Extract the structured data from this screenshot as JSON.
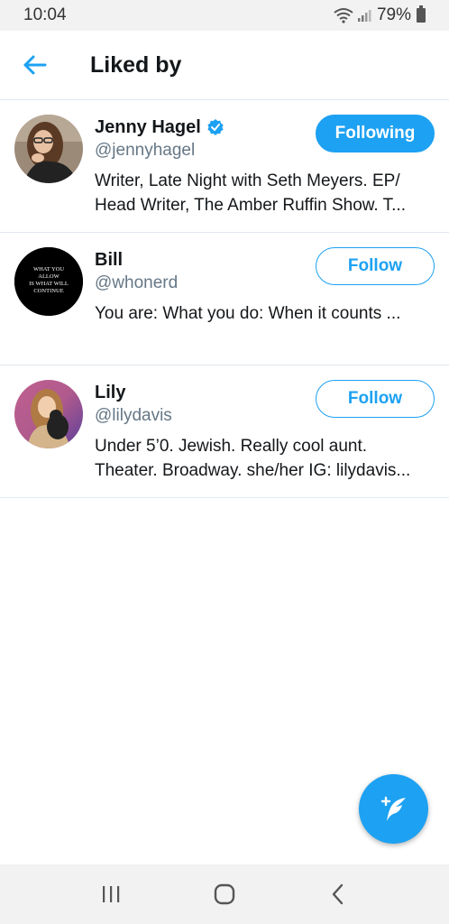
{
  "status_bar": {
    "time": "10:04",
    "battery": "79%"
  },
  "header": {
    "title": "Liked by"
  },
  "users": [
    {
      "name": "Jenny Hagel",
      "verified": true,
      "handle": "@jennyhagel",
      "bio": "Writer, Late Night with Seth Meyers. EP/ Head Writer, The Amber Ruffin Show. T...",
      "button": "Following"
    },
    {
      "name": "Bill",
      "verified": false,
      "handle": "@whonerd",
      "bio": "You are: What you do: When it counts ...",
      "button": "Follow",
      "avatar_text": [
        "WHAT YOU",
        "ALLOW",
        "IS WHAT WILL",
        "CONTINUE"
      ]
    },
    {
      "name": "Lily",
      "verified": false,
      "handle": "@lilydavis",
      "bio": "Under 5’0. Jewish. Really cool aunt. Theater. Broadway. she/her IG: lilydavis...",
      "button": "Follow"
    }
  ],
  "fab": {
    "icon": "compose-tweet-icon"
  },
  "colors": {
    "accent": "#1da1f2",
    "secondary_text": "#657786",
    "divider": "#e1e8ed"
  }
}
